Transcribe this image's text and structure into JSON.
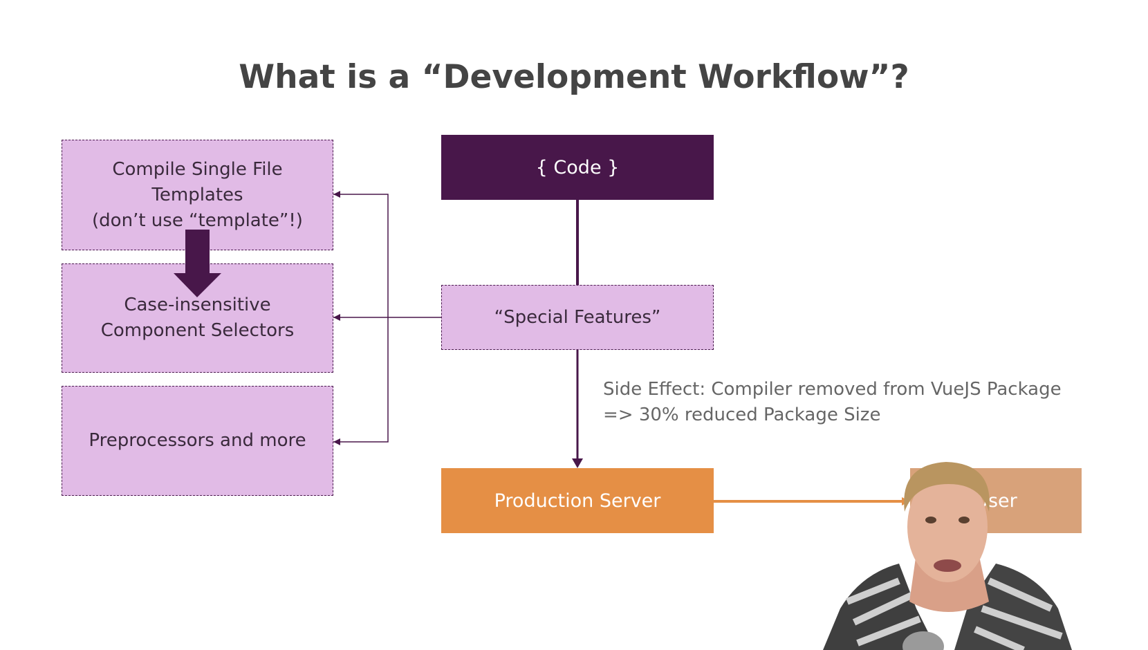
{
  "title": "What is a “Development Workflow”?",
  "left_boxes": [
    {
      "lines": [
        "Compile Single File",
        "Templates",
        "(don’t use “template”!)"
      ]
    },
    {
      "lines": [
        "Case-insensitive",
        "Component Selectors"
      ]
    },
    {
      "lines": [
        "Preprocessors and more"
      ]
    }
  ],
  "code_box": {
    "label": "{ Code }"
  },
  "special_box": {
    "label": "“Special Features”"
  },
  "side_effect": {
    "line1": "Side Effect: Compiler removed from VueJS Package",
    "line2": "=> 30% reduced Package Size"
  },
  "production_box": {
    "label": "Production Server"
  },
  "user_box": {
    "label": "User"
  },
  "colors": {
    "dark_purple": "#48174a",
    "light_purple": "#e1bbe6",
    "orange": "#e58f45",
    "light_orange": "#d8a27a",
    "title_gray": "#444444"
  }
}
